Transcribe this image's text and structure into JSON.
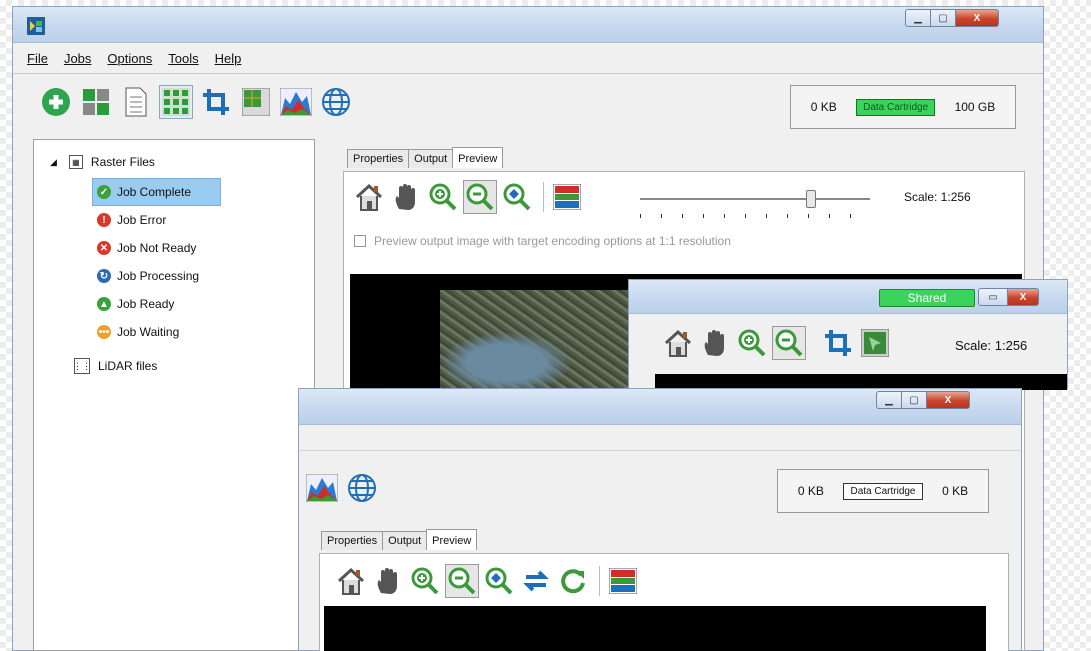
{
  "main_window": {
    "menu": [
      "File",
      "Jobs",
      "Options",
      "Tools",
      "Help"
    ],
    "toolbar_icons": [
      "add-icon",
      "layout-icon",
      "document-icon",
      "raster-grid-icon",
      "crop-icon",
      "tile-grid-icon",
      "histogram-icon",
      "globe-icon"
    ],
    "storage": {
      "left": "0 KB",
      "label": "Data Cartridge",
      "right": "100 GB",
      "color": "#3ad45c"
    },
    "tree": {
      "raster_root": "Raster Files",
      "jobs": [
        {
          "label": "Job Complete",
          "status": "complete",
          "color": "#3aa23a",
          "glyph": "✓"
        },
        {
          "label": "Job Error",
          "status": "error",
          "color": "#d8392b",
          "glyph": "!"
        },
        {
          "label": "Job Not Ready",
          "status": "not-ready",
          "color": "#d8392b",
          "glyph": "✕"
        },
        {
          "label": "Job Processing",
          "status": "processing",
          "color": "#2d6cb5",
          "glyph": "↻"
        },
        {
          "label": "Job Ready",
          "status": "ready",
          "color": "#3aa23a",
          "glyph": "▲"
        },
        {
          "label": "Job Waiting",
          "status": "waiting",
          "color": "#f0a030",
          "glyph": "•••"
        }
      ],
      "lidar_root": "LiDAR files"
    },
    "tabs": [
      "Properties",
      "Output",
      "Preview"
    ],
    "active_tab": "Preview",
    "preview_tools": [
      "home-icon",
      "pan-hand-icon",
      "zoom-in-icon",
      "zoom-out-icon",
      "zoom-fit-icon",
      "color-bands-icon"
    ],
    "scale_label": "Scale: 1:256",
    "checkbox_label": "Preview output image with target encoding options at 1:1 resolution"
  },
  "shared_window": {
    "badge": "Shared",
    "badge_color": "#3ad45c",
    "tools": [
      "home-icon",
      "pan-hand-icon",
      "zoom-in-icon",
      "zoom-out-icon",
      "crop-icon",
      "select-region-icon"
    ],
    "scale_label": "Scale: 1:256"
  },
  "front_window": {
    "toolbar_icons": [
      "histogram-icon",
      "globe-icon"
    ],
    "storage": {
      "left": "0 KB",
      "label": "Data Cartridge",
      "right": "0 KB"
    },
    "tabs": [
      "Properties",
      "Output",
      "Preview"
    ],
    "active_tab": "Preview",
    "preview_tools": [
      "home-icon",
      "pan-hand-icon",
      "zoom-in-icon",
      "zoom-out-icon",
      "zoom-fit-icon",
      "swap-icon",
      "refresh-icon",
      "color-bands-icon"
    ]
  }
}
